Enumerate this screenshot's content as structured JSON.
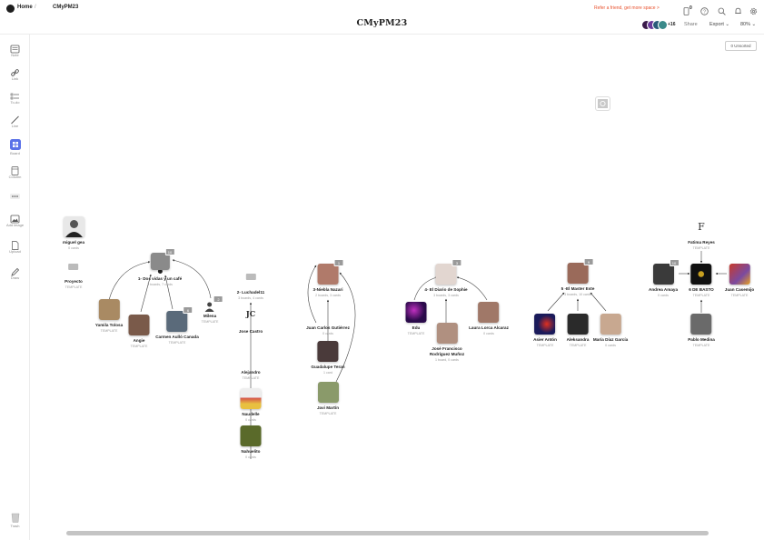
{
  "header": {
    "home_label": "Home",
    "separator": "/",
    "board_crumb": "CMyPM23",
    "board_title": "CMyPM23",
    "refer_text": "Refer a friend, get more space >",
    "device_count": "0",
    "collaborator_count": "+16",
    "share_label": "Share",
    "export_label": "Export ⌄",
    "zoom_label": "80% ⌄"
  },
  "sidebar": {
    "tools": [
      {
        "label": "Note",
        "icon": "note-icon"
      },
      {
        "label": "Link",
        "icon": "link-icon"
      },
      {
        "label": "To-do",
        "icon": "todo-icon"
      },
      {
        "label": "Line",
        "icon": "line-icon"
      },
      {
        "label": "Board",
        "icon": "board-icon"
      },
      {
        "label": "Column",
        "icon": "column-icon"
      },
      {
        "label": "",
        "icon": "more-icon"
      },
      {
        "label": "Add image",
        "icon": "image-icon"
      },
      {
        "label": "Upload",
        "icon": "upload-icon"
      },
      {
        "label": "Draw",
        "icon": "draw-icon"
      }
    ],
    "trash_label": "Trash"
  },
  "canvas": {
    "unsorted_label": "0 Unsorted",
    "nodes": [
      {
        "id": "miguel",
        "title": "miguel gea",
        "sub": "0 cards",
        "color": "#555555"
      },
      {
        "id": "proyecto",
        "title": "Proyecto",
        "sub": "TEMPLATE",
        "color": "#bbbbbb"
      },
      {
        "id": "b1",
        "title": "1- Dos vidas y un café",
        "sub": "3 boards, 7 cards",
        "color": "#8a8a8a",
        "badge": "10"
      },
      {
        "id": "yamila",
        "title": "Yamila Tolosa",
        "sub": "TEMPLATE",
        "color": "#a98a63"
      },
      {
        "id": "angie",
        "title": "Angie",
        "sub": "TEMPLATE",
        "color": "#7a5a4a"
      },
      {
        "id": "carmen",
        "title": "Carmen Aulló Canada",
        "sub": "TEMPLATE",
        "color": "#5a6a7a",
        "badge": "6"
      },
      {
        "id": "milena",
        "title": "Milena",
        "sub": "TEMPLATE",
        "color": "#444444",
        "badge": "2"
      },
      {
        "id": "b2",
        "title": "2- Luchadel11",
        "sub": "3 boards, 4 cards",
        "color": "#bbbbbb"
      },
      {
        "id": "jose",
        "title": "Jose Castro",
        "sub": "",
        "color": "#ffffff"
      },
      {
        "id": "alejandro",
        "title": "Alejandro",
        "sub": "TEMPLATE",
        "color": "#ffffff"
      },
      {
        "id": "naudelle",
        "title": "Naudelle",
        "sub": "0 cards",
        "color": "#d44a4a"
      },
      {
        "id": "nahuelito",
        "title": "Nahuelito",
        "sub": "0 cards",
        "color": "#5a6a2a"
      },
      {
        "id": "b3",
        "title": "3-Niebla Nazari",
        "sub": "2 boards, 3 cards",
        "color": "#b07a6a",
        "badge": "1"
      },
      {
        "id": "juancarlos",
        "title": "Juan Carlos Gutiérrez",
        "sub": "0 cards",
        "color": "#ffffff"
      },
      {
        "id": "guadalupe",
        "title": "Guadalupe Teran",
        "sub": "1 card",
        "color": "#4a3a3a"
      },
      {
        "id": "javi",
        "title": "Javi Martín",
        "sub": "TEMPLATE",
        "color": "#8a9a6a"
      },
      {
        "id": "b4",
        "title": "4- El Diario de Sophie",
        "sub": "3 boards, 3 cards",
        "color": "#d8c8c0",
        "badge": "3"
      },
      {
        "id": "edu",
        "title": "Edu",
        "sub": "TEMPLATE",
        "color": "#3a1a5a"
      },
      {
        "id": "josefco",
        "title": "José Francisco\nRodríguez Muñoz",
        "sub": "1 board, 0 cards",
        "color": "#b09080"
      },
      {
        "id": "laura",
        "title": "Laura Lorca Alcaraz",
        "sub": "0 cards",
        "color": "#a07868"
      },
      {
        "id": "b5",
        "title": "5 -El Master Este",
        "sub": "3 boards, 10 cards",
        "color": "#9a6a5a",
        "badge": "9"
      },
      {
        "id": "asier",
        "title": "Asier Antón",
        "sub": "TEMPLATE",
        "color": "#1a1a5a"
      },
      {
        "id": "aleksandra",
        "title": "Aleksandra",
        "sub": "TEMPLATE",
        "color": "#2a2a2a"
      },
      {
        "id": "mariadiaz",
        "title": "María Díaz García",
        "sub": "0 cards",
        "color": "#c8a890"
      },
      {
        "id": "fatima",
        "title": "Fatima Reyes",
        "sub": "TEMPLATE",
        "color": "#ffffff"
      },
      {
        "id": "andrea",
        "title": "Andrea Amaya",
        "sub": "0 cards",
        "color": "#3a3a3a",
        "badge": "10"
      },
      {
        "id": "b6",
        "title": "6 DE BASTO",
        "sub": "TEMPLATE",
        "color": "#1a1a1a"
      },
      {
        "id": "juancasem",
        "title": "Juan Casemijo",
        "sub": "TEMPLATE",
        "color": "#7a4a3a"
      },
      {
        "id": "pablo",
        "title": "Pablo Medina",
        "sub": "TEMPLATE",
        "color": "#6a6a6a"
      }
    ]
  },
  "colors": {
    "accent": "#e8512d",
    "board_tool": "#5b72e8"
  }
}
